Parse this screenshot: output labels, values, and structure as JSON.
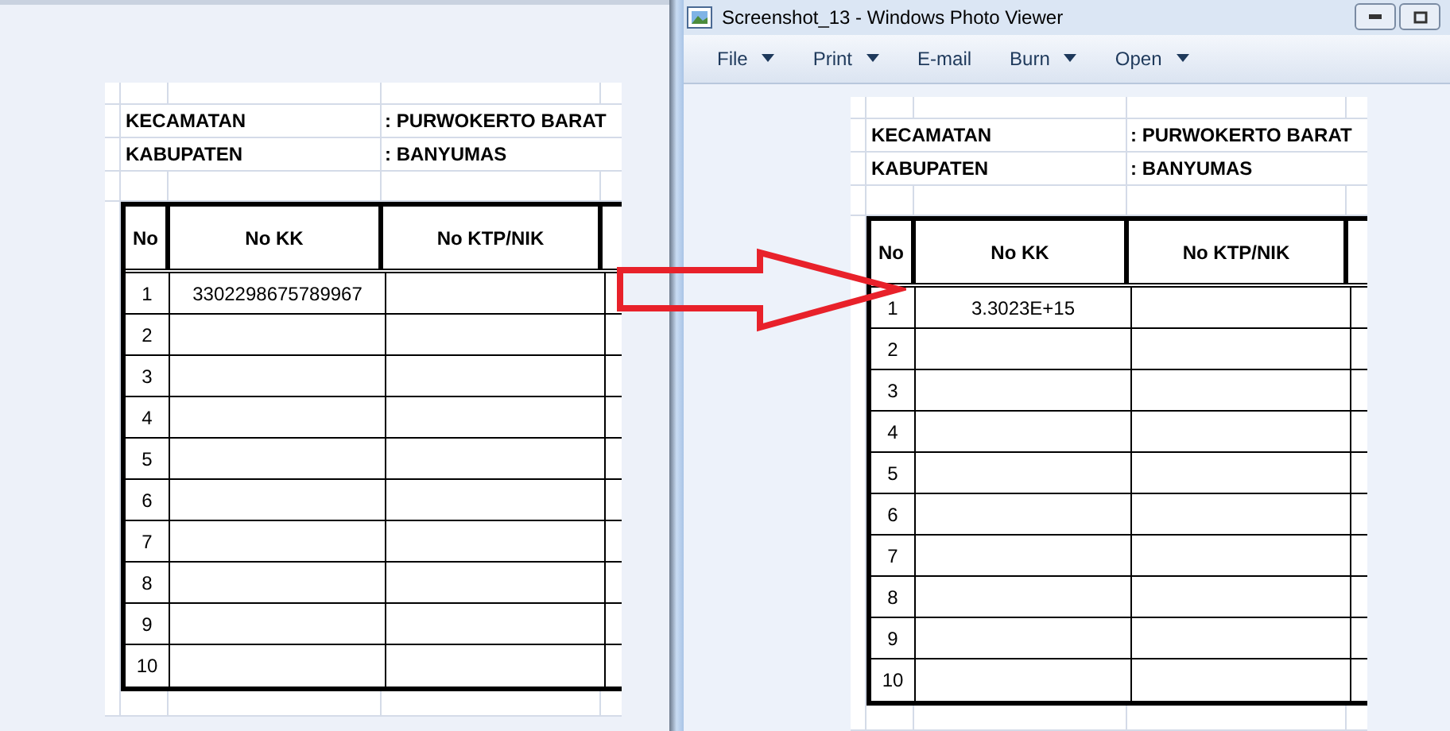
{
  "left_sheet": {
    "info_rows": [
      {
        "label": "KECAMATAN",
        "value": ": PURWOKERTO BARAT"
      },
      {
        "label": "KABUPATEN",
        "value": ": BANYUMAS"
      }
    ],
    "columns": [
      "No",
      "No KK",
      "No KTP/NIK"
    ],
    "rows": [
      {
        "no": "1",
        "no_kk": "3302298675789967"
      },
      {
        "no": "2"
      },
      {
        "no": "3"
      },
      {
        "no": "4"
      },
      {
        "no": "5"
      },
      {
        "no": "6"
      },
      {
        "no": "7"
      },
      {
        "no": "8"
      },
      {
        "no": "9"
      },
      {
        "no": "10"
      }
    ]
  },
  "photo_viewer": {
    "title": "Screenshot_13 - Windows Photo Viewer",
    "menu": [
      {
        "label": "File",
        "dropdown": true
      },
      {
        "label": "Print",
        "dropdown": true
      },
      {
        "label": "E-mail",
        "dropdown": false
      },
      {
        "label": "Burn",
        "dropdown": true
      },
      {
        "label": "Open",
        "dropdown": true
      }
    ],
    "sheet": {
      "info_rows": [
        {
          "label": "KECAMATAN",
          "value": ": PURWOKERTO BARAT"
        },
        {
          "label": "KABUPATEN",
          "value": ": BANYUMAS"
        }
      ],
      "columns": [
        "No",
        "No KK",
        "No KTP/NIK"
      ],
      "rows": [
        {
          "no": "1",
          "no_kk": "3.3023E+15"
        },
        {
          "no": "2"
        },
        {
          "no": "3"
        },
        {
          "no": "4"
        },
        {
          "no": "5"
        },
        {
          "no": "6"
        },
        {
          "no": "7"
        },
        {
          "no": "8"
        },
        {
          "no": "9"
        },
        {
          "no": "10"
        }
      ]
    }
  }
}
